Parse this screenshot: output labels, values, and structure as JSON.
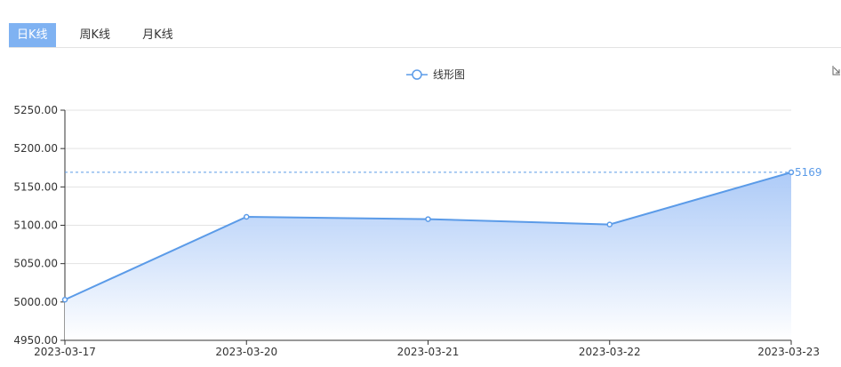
{
  "tabs": [
    {
      "label": "日K线",
      "active": true
    },
    {
      "label": "周K线",
      "active": false
    },
    {
      "label": "月K线",
      "active": false
    }
  ],
  "icons": {
    "legend_marker": "circle-line-icon",
    "corner": "restore-icon"
  },
  "colors": {
    "accent": "#7fb2f2",
    "series": "#5b9be8",
    "area_top": "#a9c8f7",
    "area_bottom": "#ffffff"
  },
  "chart_data": {
    "type": "area",
    "legend": "线形图",
    "categories": [
      "2023-03-17",
      "2023-03-20",
      "2023-03-21",
      "2023-03-22",
      "2023-03-23"
    ],
    "series": [
      {
        "name": "线形图",
        "values": [
          5003,
          5111,
          5108,
          5101,
          5169
        ]
      }
    ],
    "y_ticks": [
      "4950.00",
      "5000.00",
      "5050.00",
      "5100.00",
      "5150.00",
      "5200.00",
      "5250.00"
    ],
    "ylim": [
      4950,
      5250
    ],
    "mark_line": {
      "value": 5169,
      "label": "5169"
    },
    "grid": true,
    "legend_position": "top-center"
  }
}
